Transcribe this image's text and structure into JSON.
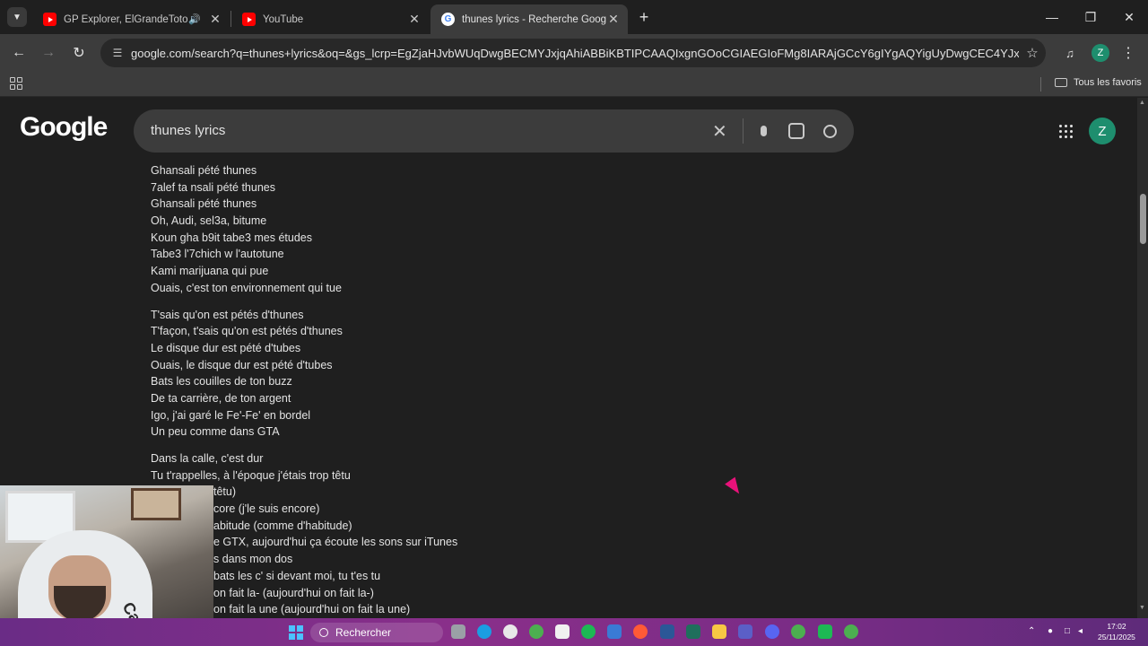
{
  "browser": {
    "tabs": [
      {
        "title": "GP Explorer, ElGrandeToto, Ze",
        "favicon": "youtube-icon",
        "audio": true
      },
      {
        "title": "YouTube",
        "favicon": "youtube-icon"
      },
      {
        "title": "thunes lyrics - Recherche Google",
        "favicon": "google-icon",
        "active": true
      }
    ],
    "url": "google.com/search?q=thunes+lyrics&oq=&gs_lcrp=EgZjaHJvbWUqDwgBECMYJxjqAhiABBiKBTIPCAAQIxgnGOoCGIAEGIoFMg8IARAjGCcY6gIYgAQYigUyDwgCEC4YJxjqA...",
    "profile_initial": "Z",
    "bookmarks_folder": "Tous les favoris"
  },
  "google": {
    "logo": "Google",
    "query": "thunes lyrics",
    "avatar_initial": "Z"
  },
  "lyrics": [
    [
      "Ghansali pété thunes",
      "7alef ta nsali pété thunes",
      "Ghansali pété thunes",
      "Oh, Audi, sel3a, bitume",
      "Koun gha b9it tabe3 mes études",
      "Tabe3 l'7chich w l'autotune",
      "Kami marijuana qui pue",
      "Ouais, c'est ton environnement qui tue"
    ],
    [
      "T'sais qu'on est pétés d'thunes",
      "T'façon, t'sais qu'on est pétés d'thunes",
      "Le disque dur est pété d'tubes",
      "Ouais, le disque dur est pété d'tubes",
      "Bats les couilles de ton buzz",
      "De ta carrière, de ton argent",
      "Igo, j'ai garé le Fe'-Fe' en bordel",
      "Un peu comme dans GTA"
    ],
    [
      "Dans la calle, c'est dur",
      "Tu t'rappelles, à l'époque j'étais trop têtu",
      "têtu)",
      "core (j'le suis encore)",
      "abitude (comme d'habitude)",
      "e GTX, aujourd'hui ça écoute les sons sur iTunes",
      "s dans mon dos",
      "bats les c' si devant moi, tu t'es tu",
      "on fait la- (aujourd'hui on fait la-)",
      "on fait la une (aujourd'hui on fait la une)"
    ]
  ],
  "webcam": {
    "shirt_text": "Calvi"
  },
  "taskbar": {
    "search_label": "Rechercher",
    "time": "17:02",
    "date": "25/11/2025"
  },
  "colors": {
    "accent": "#1e8e6e",
    "taskbar": "#7a2c86",
    "cursor": "#e8127a"
  }
}
